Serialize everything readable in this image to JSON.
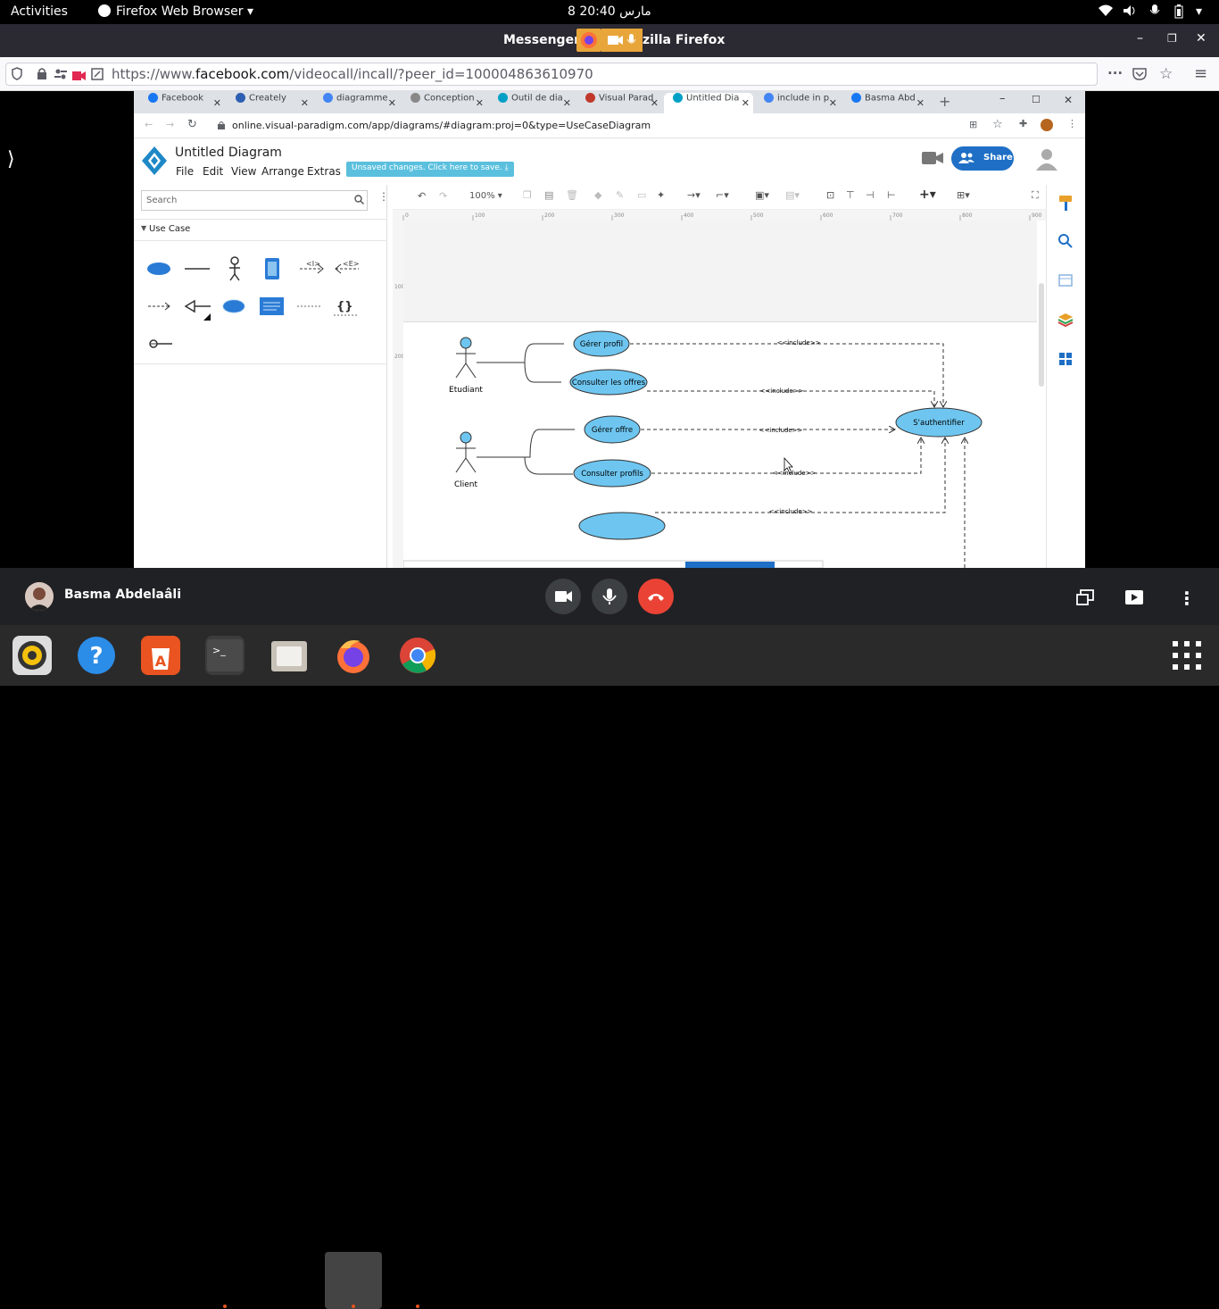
{
  "topbar": {
    "activities": "Activities",
    "app_name": "Firefox Web Browser",
    "clock": "8 مارس  20:40"
  },
  "firefox": {
    "title_left": "Messenger",
    "title_right": "zilla Firefox",
    "url_prefix": "https://www.",
    "url_domain": "facebook.com",
    "url_path": "/videocall/incall/?peer_id=100004863610970"
  },
  "chrome": {
    "tabs": [
      {
        "label": "Facebook",
        "color": "#1877f2"
      },
      {
        "label": "Creately",
        "color": "#2d5fb2"
      },
      {
        "label": "diagramme",
        "color": "#4285f4"
      },
      {
        "label": "Conception",
        "color": "#888888"
      },
      {
        "label": "Outil de dia",
        "color": "#00a0c6"
      },
      {
        "label": "Visual Parad",
        "color": "#c0392b"
      },
      {
        "label": "Untitled Dia",
        "color": "#00a0c6"
      },
      {
        "label": "include in p",
        "color": "#4285f4"
      },
      {
        "label": "Basma Abd",
        "color": "#1877f2"
      }
    ],
    "address": "online.visual-paradigm.com/app/diagrams/#diagram:proj=0&type=UseCaseDiagram"
  },
  "vp": {
    "title": "Untitled Diagram",
    "menus": [
      "File",
      "Edit",
      "View",
      "Arrange",
      "Extras"
    ],
    "unsaved": "Unsaved changes. Click here to save.",
    "share": "Share",
    "search_placeholder": "Search",
    "section": "Use Case",
    "zoom": "100%",
    "ruler_h": [
      "0",
      "100",
      "200",
      "300",
      "400",
      "500",
      "600",
      "700",
      "800",
      "900"
    ],
    "ruler_v": [
      "100",
      "200"
    ]
  },
  "diagram": {
    "actors": [
      "Etudiant",
      "Client"
    ],
    "usecases": [
      "Gérer profil",
      "Consulter les offres",
      "Gérer offre",
      "Consulter profils",
      "S'authentifier"
    ],
    "include_label": "<<include>>"
  },
  "meet": {
    "caller": "Basma Abdelaâli"
  },
  "colors": {
    "usecase_fill": "#6ec6f0",
    "accent": "#1a73e8",
    "hangup": "#ea4335"
  }
}
